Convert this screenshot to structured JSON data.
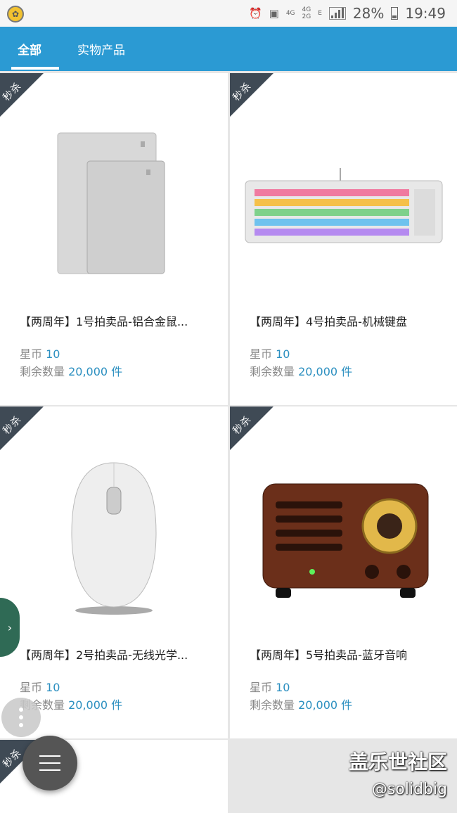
{
  "status_bar": {
    "net_top": "4G",
    "net_stack_top": "4G",
    "net_stack_bottom": "2G",
    "data_type": "E",
    "battery": "28%",
    "time": "19:49"
  },
  "tabs": [
    {
      "label": "全部",
      "active": true
    },
    {
      "label": "实物产品",
      "active": false
    }
  ],
  "ribbon_label": "秒杀",
  "labels": {
    "price": "星币",
    "stock": "剩余数量"
  },
  "products": [
    {
      "title": "【两周年】1号拍卖品-铝合金鼠...",
      "price": "10",
      "stock": "20,000 件",
      "image": "aluminum-mousepad"
    },
    {
      "title": "【两周年】4号拍卖品-机械键盘",
      "price": "10",
      "stock": "20,000 件",
      "image": "mechanical-keyboard"
    },
    {
      "title": "【两周年】2号拍卖品-无线光学...",
      "price": "10",
      "stock": "20,000 件",
      "image": "wireless-mouse"
    },
    {
      "title": "【两周年】5号拍卖品-蓝牙音响",
      "price": "10",
      "stock": "20,000 件",
      "image": "bluetooth-radio-speaker"
    }
  ],
  "watermark": {
    "title": "盖乐世社区",
    "user": "@solidbig"
  },
  "colors": {
    "accent": "#2b9ad3",
    "value_text": "#2b8fc0",
    "ribbon": "#3f4a55"
  }
}
